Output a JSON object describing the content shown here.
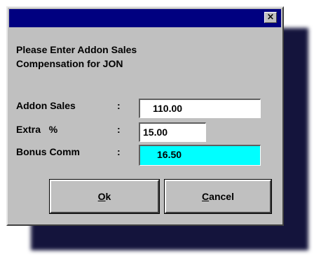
{
  "window": {
    "title": "",
    "close_glyph": "×",
    "close_icon": "close-icon"
  },
  "message": {
    "line1": "Please Enter Addon Sales",
    "line2": "Compensation for JON"
  },
  "fields": [
    {
      "label": "Addon Sales",
      "separator": ":",
      "value": "110.00"
    },
    {
      "label": "Extra   %",
      "separator": ":",
      "value": "15.00"
    },
    {
      "label": "Bonus Comm",
      "separator": ":",
      "value": "16.50"
    }
  ],
  "buttons": {
    "ok": {
      "accel": "O",
      "rest": "k"
    },
    "cancel": {
      "accel": "C",
      "rest": "ancel"
    }
  },
  "colors": {
    "title_bar": "#000080",
    "dialog_face": "#c0c0c0",
    "input_bg": "#ffffff",
    "bonus_field_bg": "#00ffff",
    "shadow": "#14143c"
  }
}
